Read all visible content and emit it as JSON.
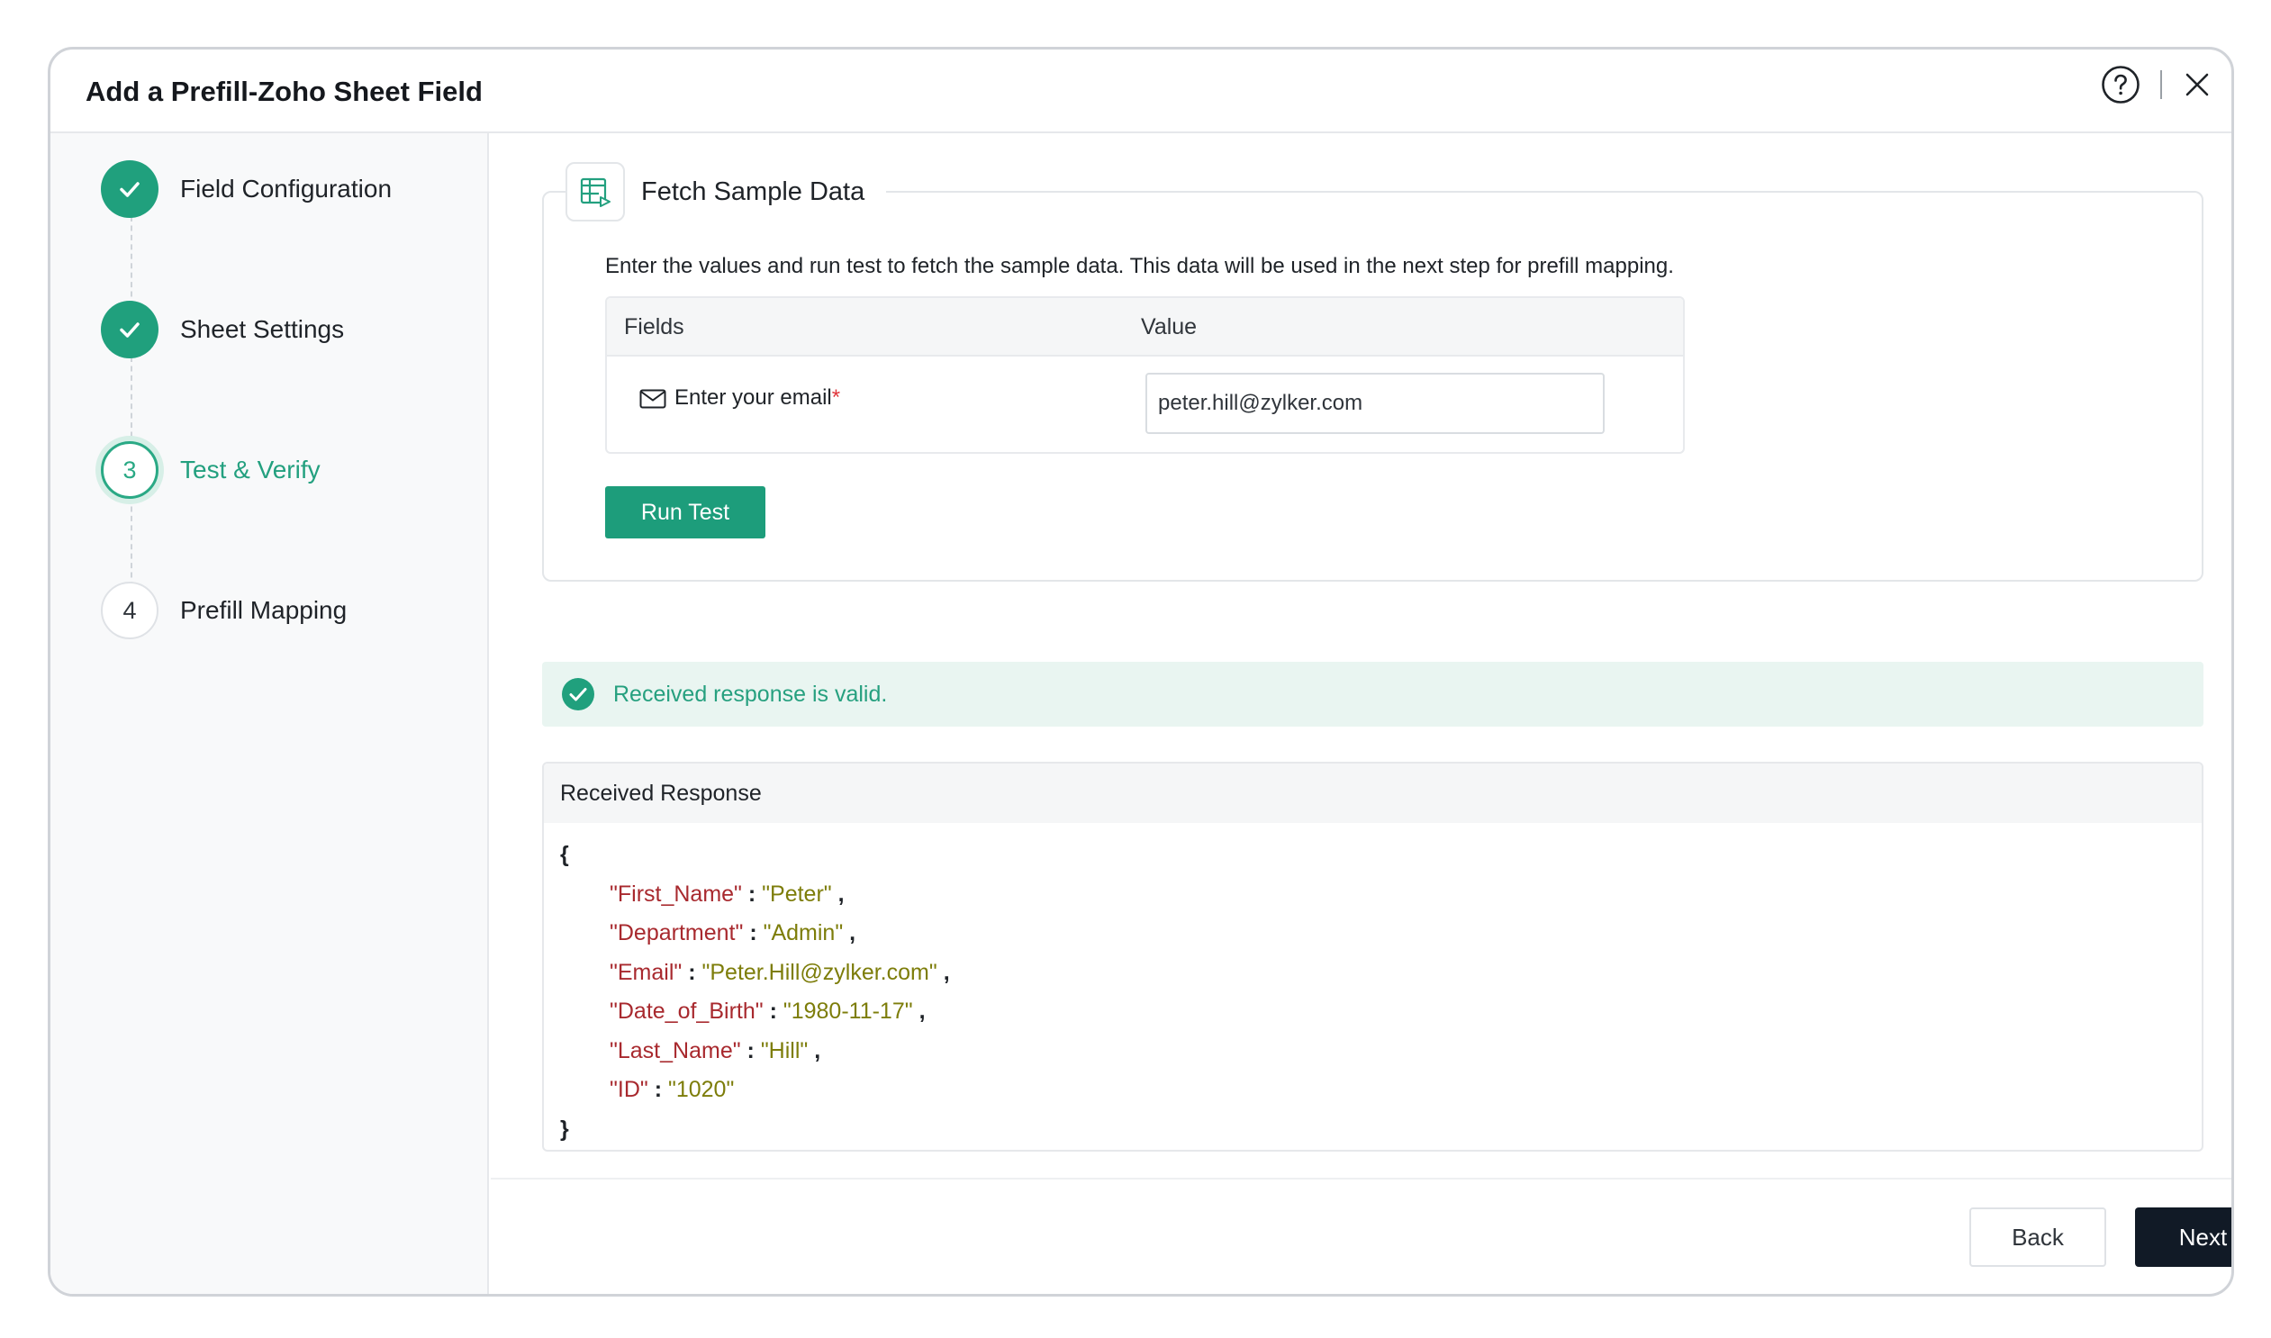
{
  "dialog": {
    "title": "Add a Prefill-Zoho Sheet Field",
    "help_icon": "question-circle-icon",
    "close_icon": "close-icon"
  },
  "steps": [
    {
      "number": "1",
      "label": "Field Configuration",
      "state": "completed"
    },
    {
      "number": "2",
      "label": "Sheet Settings",
      "state": "completed"
    },
    {
      "number": "3",
      "label": "Test & Verify",
      "state": "active"
    },
    {
      "number": "4",
      "label": "Prefill Mapping",
      "state": "pending"
    }
  ],
  "fetch": {
    "icon": "sheet-icon",
    "title": "Fetch Sample Data",
    "description": "Enter the values and run test to fetch the sample data. This data will be used in the next step for prefill mapping.",
    "table": {
      "headers": [
        "Fields",
        "Value"
      ],
      "rows": [
        {
          "icon": "mail-icon",
          "label": "Enter your email",
          "required": "*",
          "value": "peter.hill@zylker.com"
        }
      ]
    },
    "run_button": "Run Test"
  },
  "status": {
    "icon": "check-circle-icon",
    "message": "Received response is valid.",
    "color": "#26a07f"
  },
  "response": {
    "title": "Received Response",
    "open_brace": "{",
    "close_brace": "}",
    "entries": [
      {
        "key": "\"First_Name\"",
        "value": "\"Peter\"",
        "trail": ","
      },
      {
        "key": "\"Department\"",
        "value": "\"Admin\"",
        "trail": ","
      },
      {
        "key": "\"Email\"",
        "value": "\"Peter.Hill@zylker.com\"",
        "trail": ","
      },
      {
        "key": "\"Date_of_Birth\"",
        "value": "\"1980-11-17\"",
        "trail": ","
      },
      {
        "key": "\"Last_Name\"",
        "value": "\"Hill\"",
        "trail": ","
      },
      {
        "key": "\"ID\"",
        "value": "\"1020\"",
        "trail": ""
      }
    ]
  },
  "footer": {
    "back": "Back",
    "next": "Next"
  },
  "colors": {
    "accent": "#1d9d7b",
    "primary_button": "#111a26",
    "json_key": "#a8292e",
    "json_value": "#7d7d0a"
  }
}
